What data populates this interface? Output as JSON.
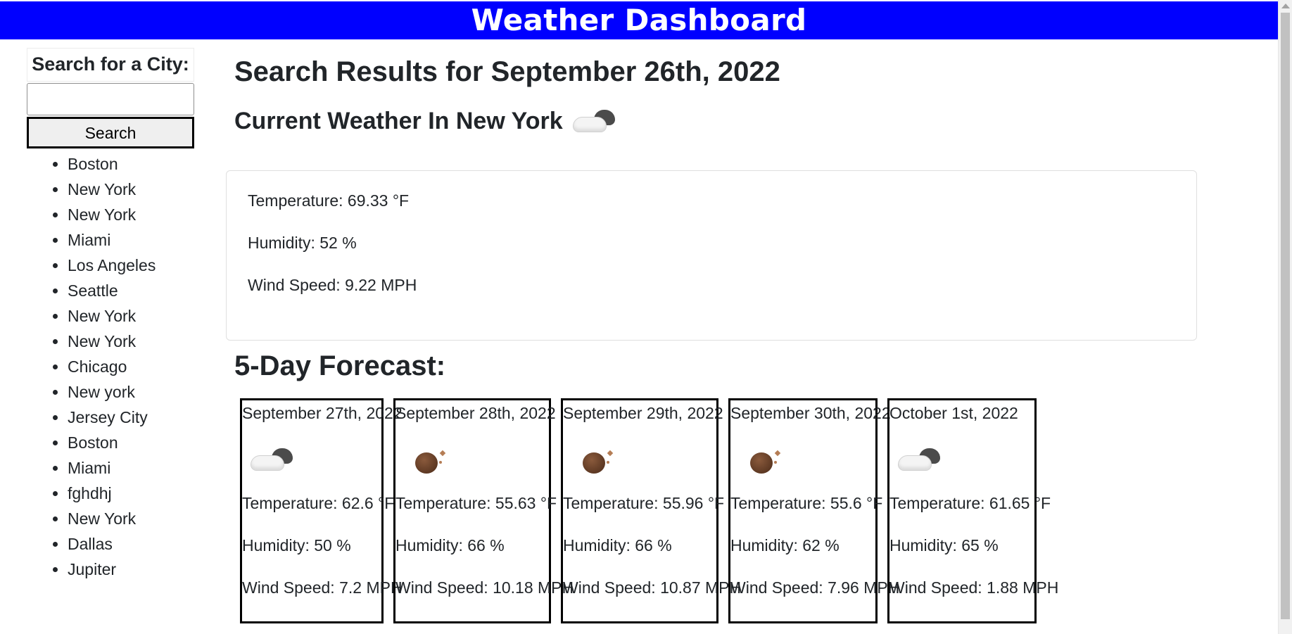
{
  "header": {
    "title": "Weather Dashboard"
  },
  "sidebar": {
    "search_label": "Search for a City:",
    "search_value": "",
    "search_button": "Search",
    "history": [
      "Boston",
      "New York",
      "New York",
      "Miami",
      "Los Angeles",
      "Seattle",
      "New York",
      "New York",
      "Chicago",
      "New york",
      "Jersey City",
      "Boston",
      "Miami",
      "fghdhj",
      "New York",
      "Dallas",
      "Jupiter"
    ]
  },
  "main": {
    "results_title": "Search Results for September 26th, 2022",
    "current_title": "Current Weather In New York",
    "current_icon": "partly-cloudy-icon",
    "current": {
      "temperature": "Temperature: 69.33 °F",
      "humidity": "Humidity: 52 %",
      "wind": "Wind Speed: 9.22 MPH"
    },
    "forecast_title": "5-Day Forecast:",
    "forecast": [
      {
        "date": "September 27th, 2022",
        "icon": "partly-cloudy-icon",
        "temperature": "Temperature: 62.6 °F",
        "humidity": "Humidity: 50 %",
        "wind": "Wind Speed: 7.2 MPH"
      },
      {
        "date": "September 28th, 2022",
        "icon": "clear-night-icon",
        "temperature": "Temperature: 55.63 °F",
        "humidity": "Humidity: 66 %",
        "wind": "Wind Speed: 10.18 MPH"
      },
      {
        "date": "September 29th, 2022",
        "icon": "clear-night-icon",
        "temperature": "Temperature: 55.96 °F",
        "humidity": "Humidity: 66 %",
        "wind": "Wind Speed: 10.87 MPH"
      },
      {
        "date": "September 30th, 2022",
        "icon": "clear-night-icon",
        "temperature": "Temperature: 55.6 °F",
        "humidity": "Humidity: 62 %",
        "wind": "Wind Speed: 7.96 MPH"
      },
      {
        "date": "October 1st, 2022",
        "icon": "partly-cloudy-icon",
        "temperature": "Temperature: 61.65 °F",
        "humidity": "Humidity: 65 %",
        "wind": "Wind Speed: 1.88 MPH"
      }
    ]
  },
  "colors": {
    "header_bg": "#0000ff",
    "header_text": "#ffffff"
  }
}
